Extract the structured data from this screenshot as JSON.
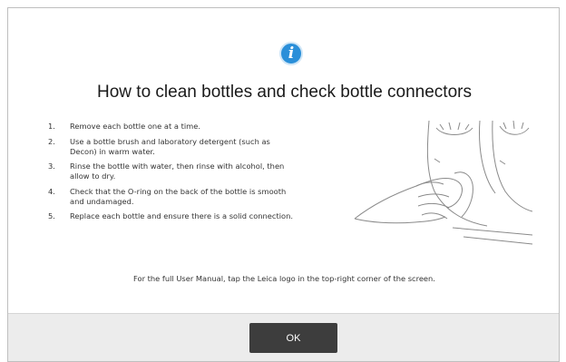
{
  "dialog": {
    "icon": "info-icon",
    "title": "How to clean bottles and check bottle connectors",
    "steps": [
      {
        "num": "1.",
        "text": "Remove each bottle one at a time."
      },
      {
        "num": "2.",
        "text": "Use a bottle brush and laboratory detergent (such as Decon) in warm water."
      },
      {
        "num": "3.",
        "text": "Rinse the bottle with water, then rinse with alcohol, then allow to dry."
      },
      {
        "num": "4.",
        "text": "Check that the O-ring on the back of the bottle is smooth and undamaged."
      },
      {
        "num": "5.",
        "text": "Replace each bottle and ensure there is a solid connection."
      }
    ],
    "manual_note": "For the full User Manual, tap the Leica logo in the top-right corner of the screen.",
    "ok_label": "OK"
  },
  "colors": {
    "info_blue": "#2a8fd9",
    "button_dark": "#3d3d3d",
    "footer_gray": "#ececec"
  }
}
